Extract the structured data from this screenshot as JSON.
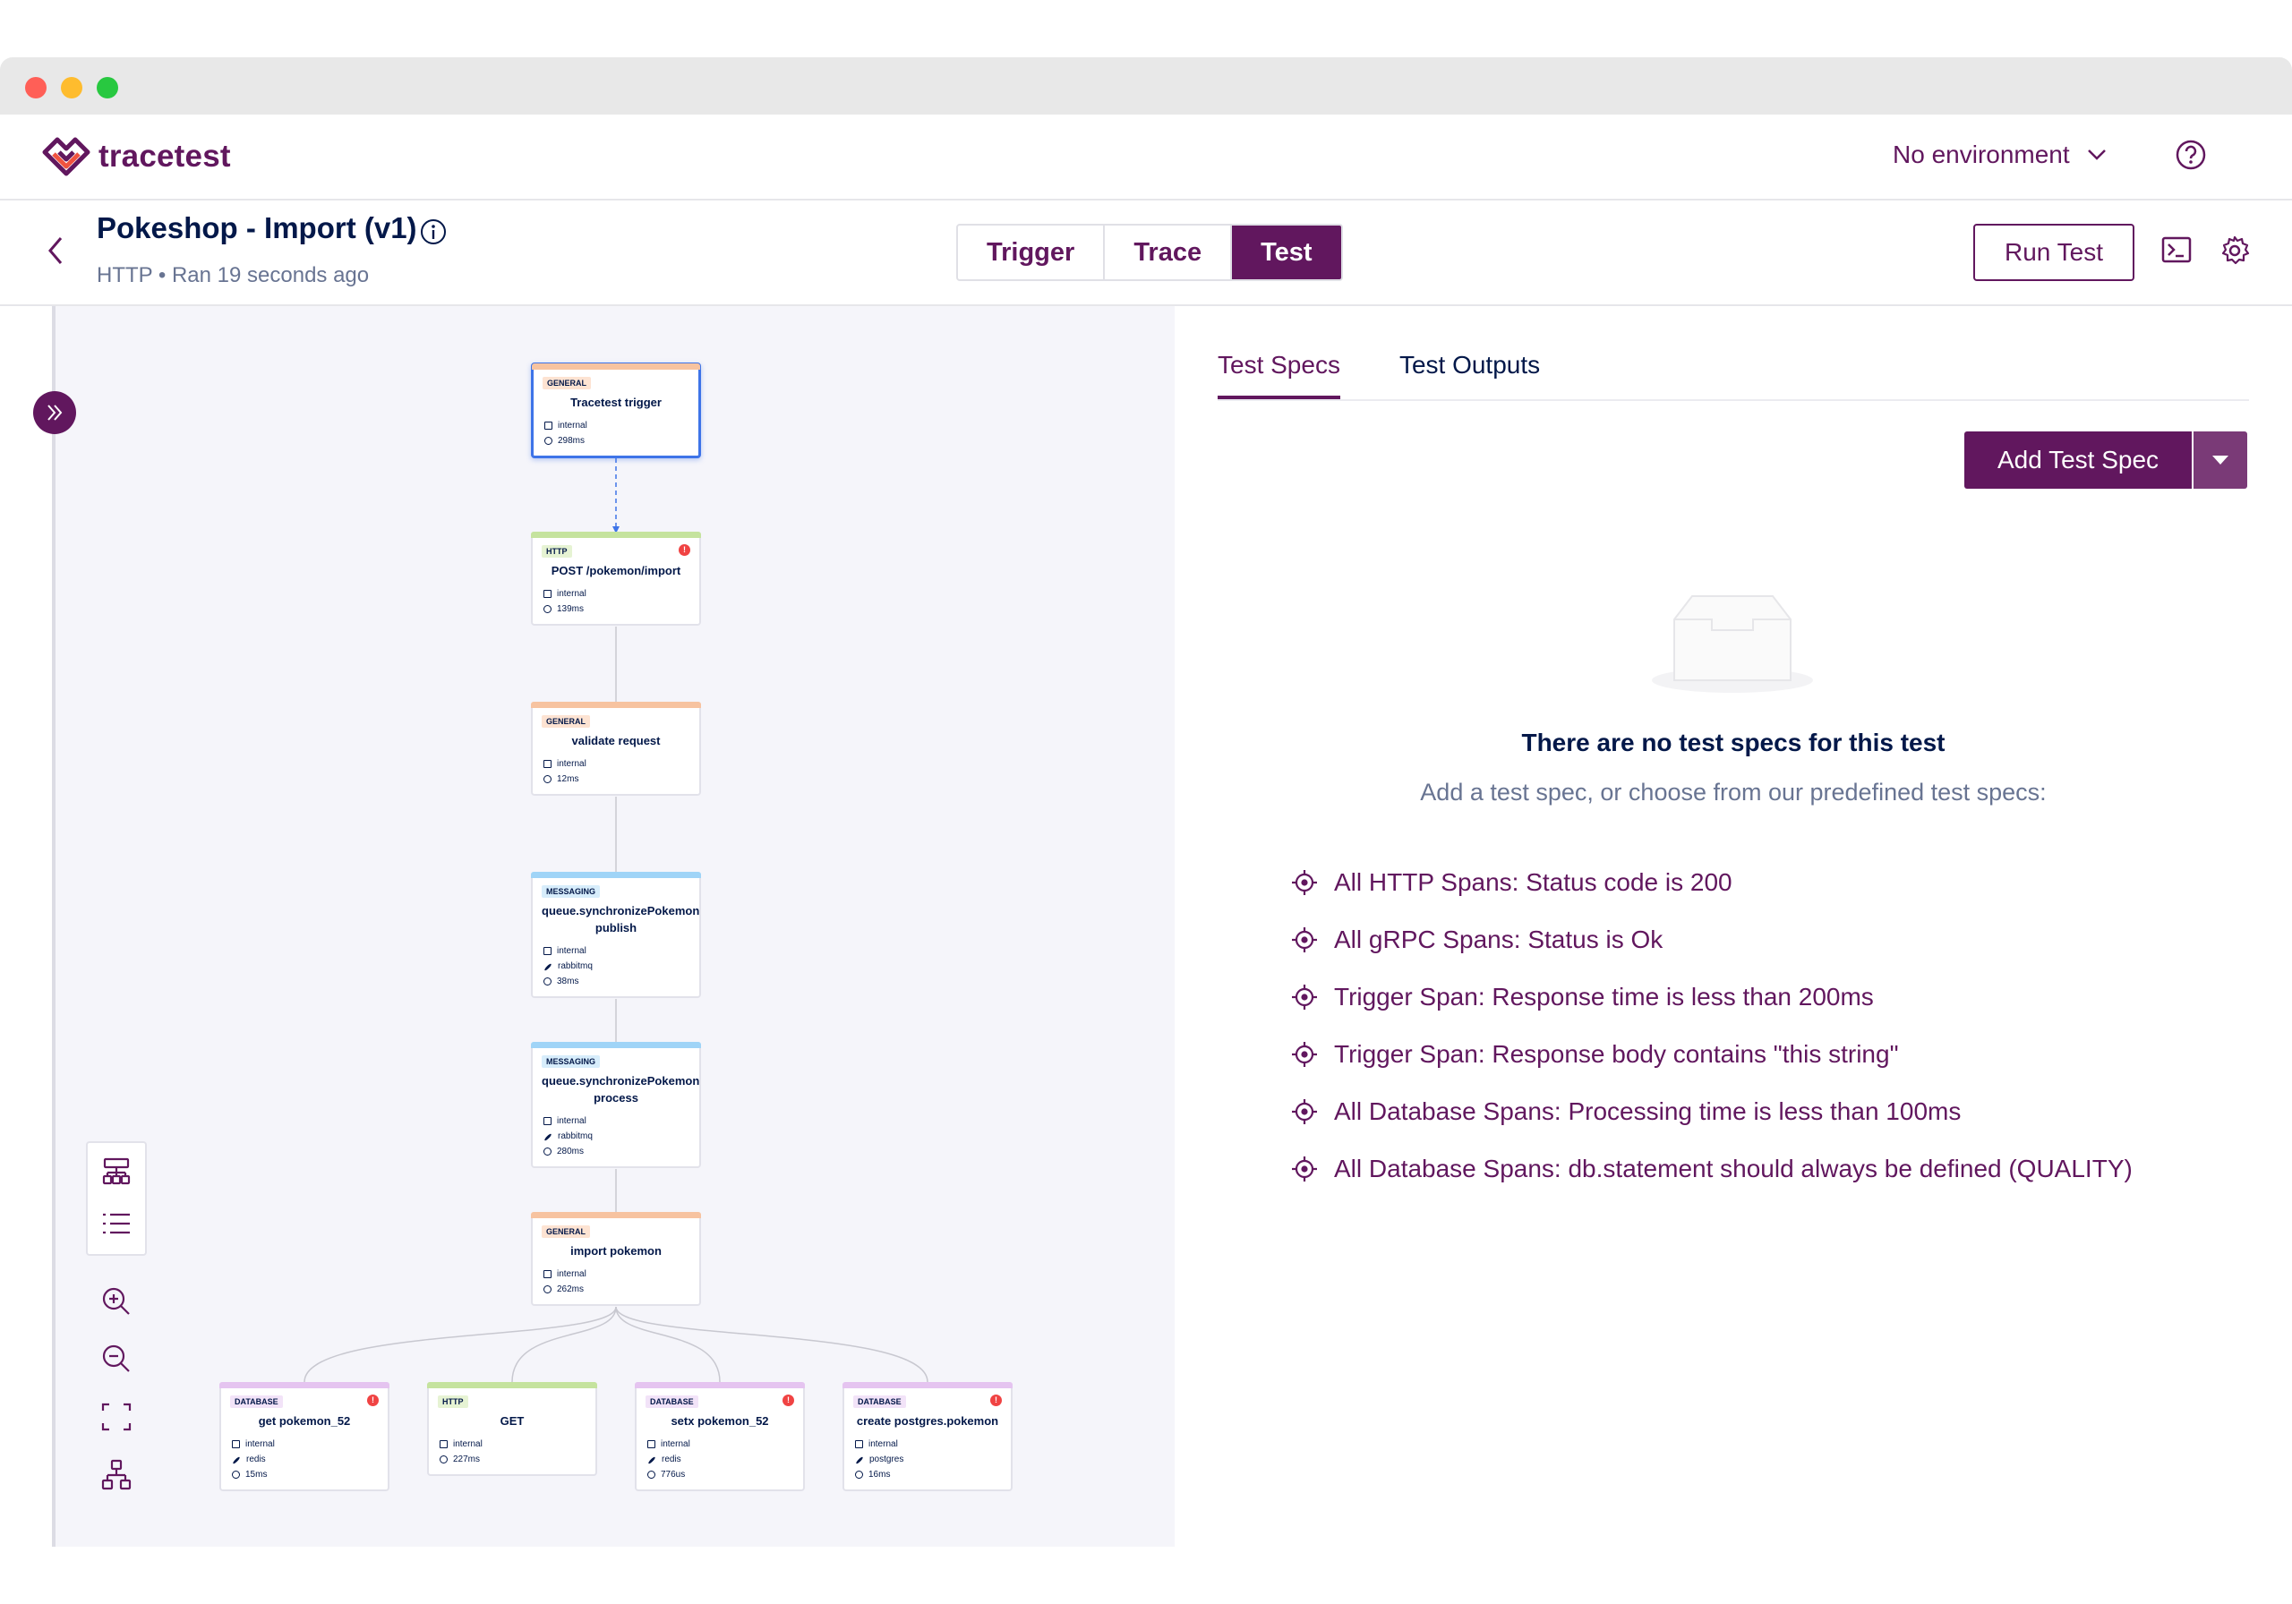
{
  "app": {
    "name": "tracetest"
  },
  "header": {
    "environment": "No environment"
  },
  "test": {
    "title": "Pokeshop - Import (v1)",
    "subtitle": "HTTP • Ran 19 seconds ago",
    "modes": [
      "Trigger",
      "Trace",
      "Test"
    ],
    "active_mode": "Test",
    "run_label": "Run Test"
  },
  "trace_nodes": [
    {
      "id": "n1",
      "type": "GENERAL",
      "name": "Tracetest trigger",
      "meta": [
        "internal",
        "298ms"
      ],
      "error": false,
      "selected": true
    },
    {
      "id": "n2",
      "type": "HTTP",
      "name": "POST /pokemon/import",
      "meta": [
        "internal",
        "139ms"
      ],
      "error": true
    },
    {
      "id": "n3",
      "type": "GENERAL",
      "name": "validate request",
      "meta": [
        "internal",
        "12ms"
      ],
      "error": false
    },
    {
      "id": "n4",
      "type": "MESSAGING",
      "name": "queue.synchronizePokemon publish",
      "meta": [
        "internal",
        "rabbitmq",
        "38ms"
      ],
      "error": false
    },
    {
      "id": "n5",
      "type": "MESSAGING",
      "name": "queue.synchronizePokemon process",
      "meta": [
        "internal",
        "rabbitmq",
        "280ms"
      ],
      "error": false
    },
    {
      "id": "n6",
      "type": "GENERAL",
      "name": "import pokemon",
      "meta": [
        "internal",
        "262ms"
      ],
      "error": false
    },
    {
      "id": "n7",
      "type": "DATABASE",
      "name": "get pokemon_52",
      "meta": [
        "internal",
        "redis",
        "15ms"
      ],
      "error": true
    },
    {
      "id": "n8",
      "type": "HTTP",
      "name": "GET",
      "meta": [
        "internal",
        "227ms"
      ],
      "error": false
    },
    {
      "id": "n9",
      "type": "DATABASE",
      "name": "setx pokemon_52",
      "meta": [
        "internal",
        "redis",
        "776us"
      ],
      "error": true
    },
    {
      "id": "n10",
      "type": "DATABASE",
      "name": "create postgres.pokemon",
      "meta": [
        "internal",
        "postgres",
        "16ms"
      ],
      "error": true
    }
  ],
  "right_panel": {
    "tabs": [
      "Test Specs",
      "Test Outputs"
    ],
    "active_tab": "Test Specs",
    "add_button": "Add Test Spec",
    "empty_title": "There are no test specs for this test",
    "empty_subtitle": "Add a test spec, or choose from our predefined test specs:",
    "suggestions": [
      "All HTTP Spans: Status code is 200",
      "All gRPC Spans: Status is Ok",
      "Trigger Span: Response time is less than 200ms",
      "Trigger Span: Response body contains \"this string\"",
      "All Database Spans: Processing time is less than 100ms",
      "All Database Spans: db.statement should always be defined (QUALITY)"
    ]
  },
  "colors": {
    "brand": "#61175e",
    "selected": "#3e74e8",
    "error": "#f04343"
  }
}
